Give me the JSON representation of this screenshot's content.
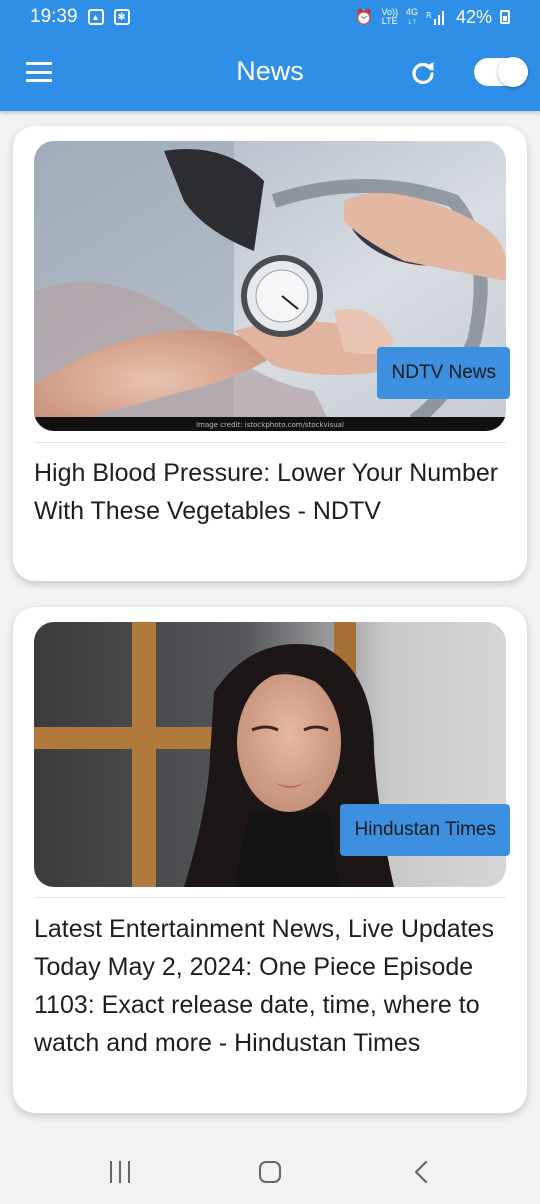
{
  "status_bar": {
    "time": "19:39",
    "network_top": "Vo))",
    "network_bottom": "LTE",
    "gen": "4G",
    "battery": "42%"
  },
  "app_bar": {
    "title": "News",
    "icons": [
      "menu-icon",
      "refresh-icon",
      "toggle-switch"
    ],
    "toggle_on": true,
    "color": "#2f8fe6"
  },
  "articles": [
    {
      "source": "NDTV News",
      "image_credit": "Image credit: istockphoto.com/stockvisual",
      "headline": "High Blood Pressure: Lower Your Number With These Vegetables - NDTV"
    },
    {
      "source": "Hindustan Times",
      "headline": "Latest Entertainment News, Live Updates Today May 2, 2024: One Piece Episode 1103: Exact release date, time, where to watch and more - Hindustan Times"
    }
  ],
  "nav_bar": {
    "icons": [
      "recents-icon",
      "home-icon",
      "back-icon"
    ]
  }
}
